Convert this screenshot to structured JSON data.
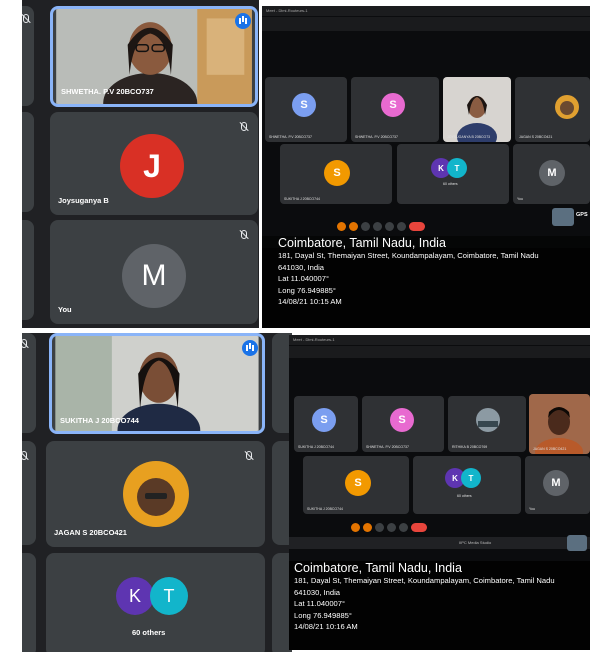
{
  "colors": {
    "meet_dark": "#202124",
    "tile_gray": "#3c4043",
    "active_blue": "#8ab4f8",
    "avatar_j": "#d93025",
    "avatar_m": "#5f6368",
    "avatar_s_blue": "#7b9ef0",
    "avatar_s_pink": "#e86ad0",
    "avatar_s_orange": "#f29900",
    "avatar_k": "#5e35b1",
    "avatar_t": "#12b5cb"
  },
  "top_phone": {
    "tiles": [
      {
        "name": "SHWETHA. P.V 20BCO737",
        "state": "speaking"
      },
      {
        "name": "Joysuganya B",
        "avatar_letter": "J"
      },
      {
        "name": "You",
        "avatar_letter": "M"
      }
    ]
  },
  "bottom_phone": {
    "tiles": [
      {
        "name": "SUKITHA J 20BCO744",
        "state": "speaking"
      },
      {
        "name": "JAGAN S 20BCO421"
      },
      {
        "name": "60 others",
        "avatar_letters": [
          "K",
          "T"
        ]
      }
    ]
  },
  "laptop_top": {
    "browser_title": "Meet - Dlmi-Routeurs-1",
    "tiles": [
      {
        "name": "SHWETHA. P.V 20BCO737",
        "letter": "S"
      },
      {
        "name": "SHWETHA. P.V 20BCO737",
        "letter": "S"
      },
      {
        "name": "JOYSUGANYA B 20BCO73"
      },
      {
        "name": "JAGAN S 20BCO421"
      },
      {
        "name": "SUKITHA J 20BCO744",
        "letter": "S"
      },
      {
        "name": "60 others",
        "letters": [
          "K",
          "T"
        ]
      },
      {
        "name": "You",
        "letter": "M"
      }
    ],
    "gps": {
      "app_label": "GPS",
      "city": "Coimbatore, Tamil Nadu, India",
      "address_1": "181, Dayal St, Themaiyan Street, Koundampalayam, Coimbatore, Tamil Nadu",
      "address_2": "641030, India",
      "lat": "Lat 11.040007°",
      "long": "Long 76.949885°",
      "datetime": "14/08/21 10:15 AM"
    }
  },
  "laptop_bottom": {
    "browser_title": "Meet - Dlmi-Routeurs-1",
    "taskbar_text": "IIPC Media Studio",
    "tiles": [
      {
        "name": "SUKITHA J 20BCO744",
        "letter": "S"
      },
      {
        "name": "SHWETHA. P.V 20BCO737",
        "letter": "S"
      },
      {
        "name": "RITHIKA B 20BCO769"
      },
      {
        "name": "JAGAN S 20BCO421"
      },
      {
        "name": "SUKITHA J 20BCO744",
        "letter": "S"
      },
      {
        "name": "60 others",
        "letters": [
          "K",
          "T"
        ]
      },
      {
        "name": "You",
        "letter": "M"
      }
    ],
    "gps": {
      "city": "Coimbatore, Tamil Nadu, India",
      "address_1": "181, Dayal St, Themaiyan Street, Koundampalayam, Coimbatore, Tamil Nadu",
      "address_2": "641030, India",
      "lat": "Lat 11.040007°",
      "long": "Long 76.949885°",
      "datetime": "14/08/21 10:16 AM"
    }
  }
}
